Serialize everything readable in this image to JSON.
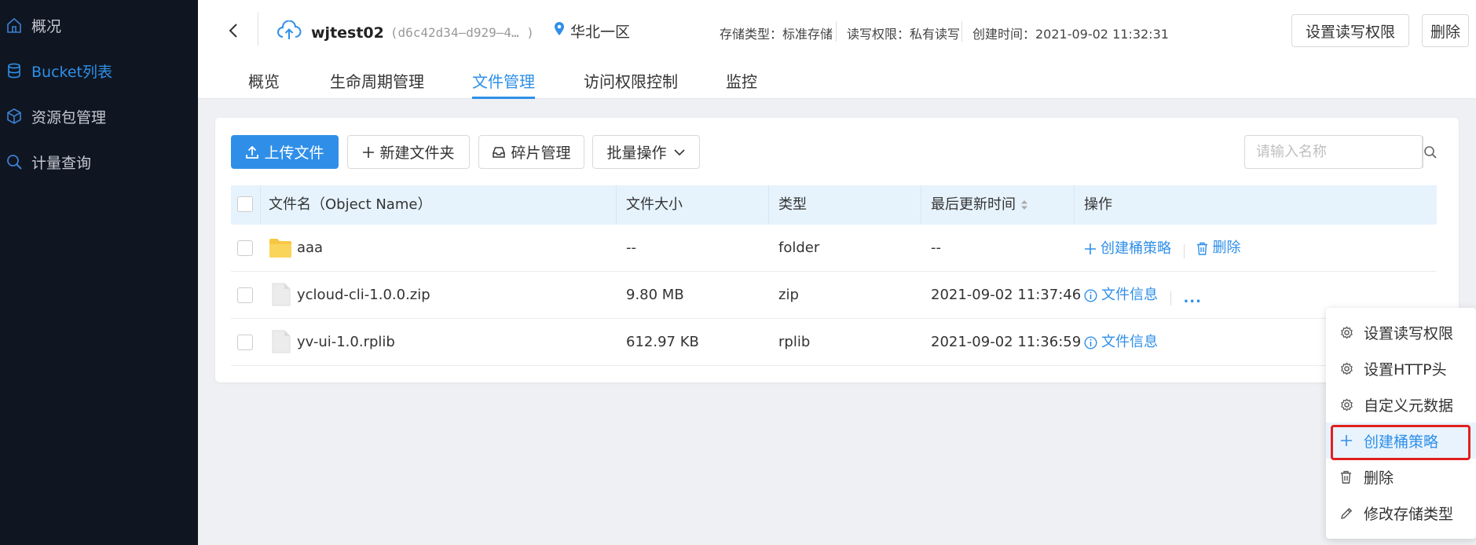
{
  "sidebar": {
    "items": [
      {
        "label": "概况",
        "icon": "home-icon",
        "active": false
      },
      {
        "label": "Bucket列表",
        "icon": "database-icon",
        "active": true
      },
      {
        "label": "资源包管理",
        "icon": "cube-icon",
        "active": false
      },
      {
        "label": "计量查询",
        "icon": "search-icon",
        "active": false
      }
    ]
  },
  "header": {
    "bucket_name": "wjtest02",
    "bucket_id": "(d6c42d34–d929–4… )",
    "region": "华北一区",
    "storage_type": "存储类型：标准存储",
    "read_write": "读写权限：私有读写",
    "created": "创建时间：2021-09-02 11:32:31",
    "set_permission_btn": "设置读写权限",
    "delete_btn": "删除"
  },
  "tabs": [
    {
      "label": "概览",
      "active": false
    },
    {
      "label": "生命周期管理",
      "active": false
    },
    {
      "label": "文件管理",
      "active": true
    },
    {
      "label": "访问权限控制",
      "active": false
    },
    {
      "label": "监控",
      "active": false
    }
  ],
  "toolbar": {
    "upload": "上传文件",
    "new_folder": "新建文件夹",
    "fragments": "碎片管理",
    "batch": "批量操作",
    "search_placeholder": "请输入名称"
  },
  "table": {
    "headers": {
      "name": "文件名（Object Name）",
      "size": "文件大小",
      "type": "类型",
      "updated": "最后更新时间",
      "ops": "操作"
    },
    "rows": [
      {
        "name": "aaa",
        "size": "--",
        "type": "folder",
        "updated": "--",
        "op1": "创建桶策略",
        "op2": "删除"
      },
      {
        "name": "ycloud-cli-1.0.0.zip",
        "size": "9.80 MB",
        "type": "zip",
        "updated": "2021-09-02 11:37:46",
        "op1": "文件信息",
        "op2": "..."
      },
      {
        "name": "yv-ui-1.0.rplib",
        "size": "612.97 KB",
        "type": "rplib",
        "updated": "2021-09-02 11:36:59",
        "op1": "文件信息",
        "op2": ""
      }
    ]
  },
  "dropdown": {
    "items": [
      {
        "label": "设置读写权限",
        "icon": "gear-icon"
      },
      {
        "label": "设置HTTP头",
        "icon": "gear-icon"
      },
      {
        "label": "自定义元数据",
        "icon": "gear-icon"
      },
      {
        "label": "创建桶策略",
        "icon": "plus-icon"
      },
      {
        "label": "删除",
        "icon": "trash-icon"
      },
      {
        "label": "修改存储类型",
        "icon": "pencil-icon"
      }
    ]
  },
  "colors": {
    "accent": "#2f8fe8",
    "sidebar_bg": "#0f1621",
    "highlight_border": "#e02020",
    "folder": "#f7c744"
  }
}
